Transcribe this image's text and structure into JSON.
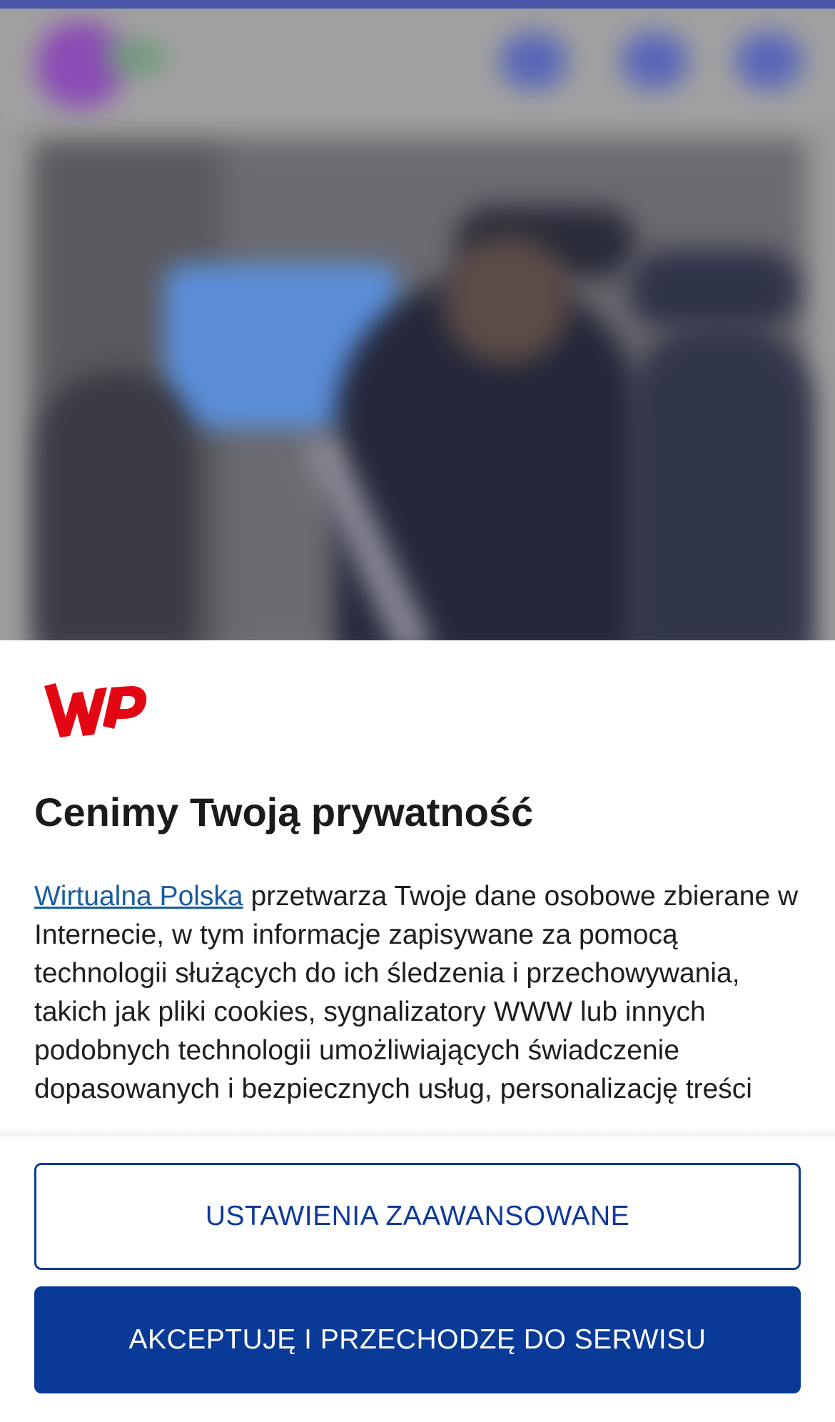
{
  "consent": {
    "title": "Cenimy Twoją prywatność",
    "link_text": "Wirtualna Polska",
    "body_text": " przetwarza Twoje dane osobowe zbierane w Internecie, w tym informacje zapisywane za pomocą technologii służących do ich śledzenia i przechowywania, takich jak pliki cookies, sygnalizatory WWW lub innych podobnych technologii umożliwiających świadczenie dopasowanych i bezpiecznych usług, personalizację treści",
    "logo_text": "WP",
    "brand_color": "#e30613"
  },
  "buttons": {
    "advanced_settings": "USTAWIENIA ZAAWANSOWANE",
    "accept": "AKCEPTUJĘ I PRZECHODZĘ DO SERWISU"
  },
  "colors": {
    "primary": "#0a3a98",
    "link": "#1a5c9e"
  }
}
